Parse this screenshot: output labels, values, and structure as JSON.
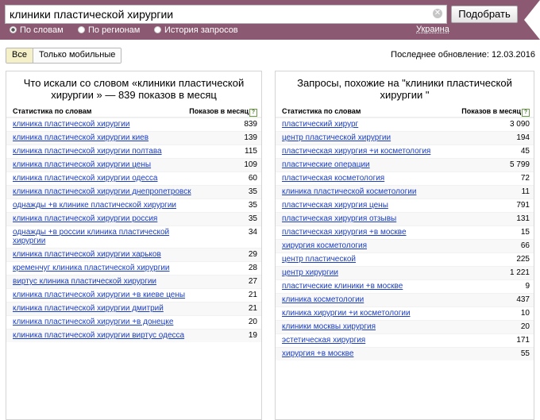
{
  "search": {
    "query": "клиники пластической хирургии",
    "submit_label": "Подобрать"
  },
  "modes": [
    {
      "label": "По словам",
      "selected": true
    },
    {
      "label": "По регионам",
      "selected": false
    },
    {
      "label": "История запросов",
      "selected": false
    }
  ],
  "region": "Украина",
  "filters": [
    {
      "label": "Все",
      "active": true
    },
    {
      "label": "Только мобильные",
      "active": false
    }
  ],
  "last_update": "Последнее обновление: 12.03.2016",
  "left_panel": {
    "title": "Что искали со словом «клиники пластической хирургии » — 839 показов в месяц",
    "col_query": "Статистика по словам",
    "col_count": "Показов в месяц",
    "rows": [
      {
        "q": "клиника пластической хирургии",
        "n": "839"
      },
      {
        "q": "клиника пластической хирургии киев",
        "n": "139"
      },
      {
        "q": "клиника пластической хирургии полтава",
        "n": "115"
      },
      {
        "q": "клиника пластической хирургии цены",
        "n": "109"
      },
      {
        "q": "клиника пластической хирургии одесса",
        "n": "60"
      },
      {
        "q": "клиника пластической хирургии днепропетровск",
        "n": "35"
      },
      {
        "q": "однажды +в клинике пластической хирургии",
        "n": "35"
      },
      {
        "q": "клиника пластической хирургии россия",
        "n": "35"
      },
      {
        "q": "однажды +в россии клиника пластической хирургии",
        "n": "34"
      },
      {
        "q": "клиника пластической хирургии харьков",
        "n": "29"
      },
      {
        "q": "кременчуг клиника пластической хирургии",
        "n": "28"
      },
      {
        "q": "виртус клиника пластической хирургии",
        "n": "27"
      },
      {
        "q": "клиника пластической хирургии +в киеве цены",
        "n": "21"
      },
      {
        "q": "клиника пластической хирургии дмитрий",
        "n": "21"
      },
      {
        "q": "клиника пластической хирургии +в донецке",
        "n": "20"
      },
      {
        "q": "клиника пластической хирургии виртус одесса",
        "n": "19"
      }
    ]
  },
  "right_panel": {
    "title": "Запросы, похожие на \"клиники пластической хирургии \"",
    "col_query": "Статистика по словам",
    "col_count": "Показов в месяц",
    "rows": [
      {
        "q": "пластический хирург",
        "n": "3 090"
      },
      {
        "q": "центр пластической хирургии",
        "n": "194"
      },
      {
        "q": "пластическая хирургия +и косметология",
        "n": "45"
      },
      {
        "q": "пластические операции",
        "n": "5 799"
      },
      {
        "q": "пластическая косметология",
        "n": "72"
      },
      {
        "q": "клиника пластической косметологии",
        "n": "11"
      },
      {
        "q": "пластическая хирургия цены",
        "n": "791"
      },
      {
        "q": "пластическая хирургия отзывы",
        "n": "131"
      },
      {
        "q": "пластическая хирургия +в москве",
        "n": "15"
      },
      {
        "q": "хирургия косметология",
        "n": "66"
      },
      {
        "q": "центр пластической",
        "n": "225"
      },
      {
        "q": "центр хирургии",
        "n": "1 221"
      },
      {
        "q": "пластические клиники +в москве",
        "n": "9"
      },
      {
        "q": "клиника косметологии",
        "n": "437"
      },
      {
        "q": "клиника хирургии +и косметологии",
        "n": "10"
      },
      {
        "q": "клиники москвы хирургия",
        "n": "20"
      },
      {
        "q": "эстетическая хирургия",
        "n": "171"
      },
      {
        "q": "хирургия +в москве",
        "n": "55"
      }
    ]
  },
  "colors": {
    "header_bg": "#8b5a72",
    "link": "#1a3dc1",
    "active_tab": "#f5f0c8"
  },
  "icons": {
    "clear": "clear-icon",
    "help": "question-icon"
  }
}
